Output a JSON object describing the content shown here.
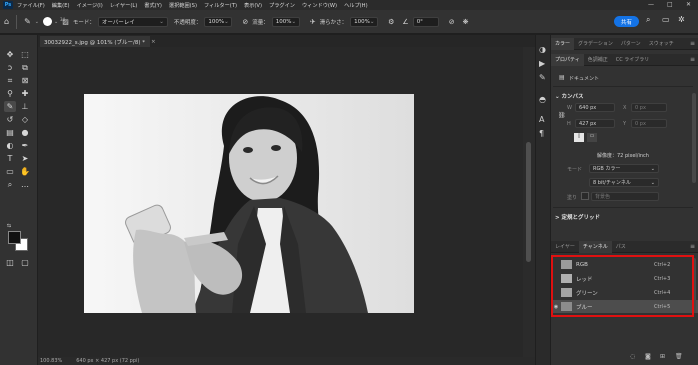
{
  "app": {
    "logo": "Ps"
  },
  "menu": [
    "ファイル(F)",
    "編集(E)",
    "イメージ(I)",
    "レイヤー(L)",
    "書式(Y)",
    "選択範囲(S)",
    "フィルター(T)",
    "表示(V)",
    "プラグイン",
    "ウィンドウ(W)",
    "ヘルプ(H)"
  ],
  "window_controls": {
    "minimize": "—",
    "maximize": "□",
    "close": "✕"
  },
  "options": {
    "brush_size": "34",
    "mode_label": "モード：",
    "mode_value": "オーバーレイ",
    "opacity_label": "不透明度：",
    "opacity_value": "100%",
    "flow_label": "流量：",
    "flow_value": "100%",
    "smoothing_label": "滑らかさ：",
    "smoothing_value": "100%",
    "angle_value": "0°",
    "share_label": "共有"
  },
  "document": {
    "tab_title": "30032922_s.jpg @ 101% (ブルー/8) *",
    "tab_close": "×"
  },
  "status": {
    "zoom": "100.83%",
    "doc_info": "640 px × 427 px (72 ppi)"
  },
  "panels": {
    "top_tabs": [
      "カラー",
      "グラデーション",
      "パターン",
      "スウォッチ"
    ],
    "prop_tabs": [
      "プロパティ",
      "色調補正",
      "CC ライブラリ"
    ],
    "prop_doc_label": "ドキュメント",
    "canvas_title": "カンバス",
    "w_label": "W",
    "w_value": "640 px",
    "x_label": "X",
    "x_placeholder": "0 px",
    "h_label": "H",
    "h_value": "427 px",
    "y_label": "Y",
    "y_placeholder": "0 px",
    "resolution": "解像度：72 pixel/inch",
    "mode_label": "モード",
    "mode_value": "RGB カラー",
    "depth_value": "8 bit/チャンネル",
    "fill_label": "塗り",
    "fill_value": "背景色",
    "guides_title": "定規とグリッド",
    "bottom_tabs": [
      "レイヤー",
      "チャンネル",
      "パス"
    ],
    "channels": [
      {
        "name": "RGB",
        "shortcut": "Ctrl+2",
        "visible": false
      },
      {
        "name": "レッド",
        "shortcut": "Ctrl+3",
        "visible": false
      },
      {
        "name": "グリーン",
        "shortcut": "Ctrl+4",
        "visible": false
      },
      {
        "name": "ブルー",
        "shortcut": "Ctrl+5",
        "visible": true
      }
    ],
    "eye_glyph": "◉"
  },
  "colors": {
    "accent": "#1473e6",
    "highlight": "#e01010",
    "foreground": "#111111",
    "background": "#ffffff"
  },
  "icons": [
    "home-icon",
    "brush-icon",
    "move-icon",
    "marquee-icon",
    "lasso-icon",
    "crop-icon",
    "eyedropper-icon",
    "healing-icon",
    "brush-tool-icon",
    "stamp-icon",
    "eraser-icon",
    "gradient-icon",
    "pen-icon",
    "type-icon",
    "hand-icon",
    "zoom-icon",
    "search-icon",
    "settings-icon"
  ]
}
